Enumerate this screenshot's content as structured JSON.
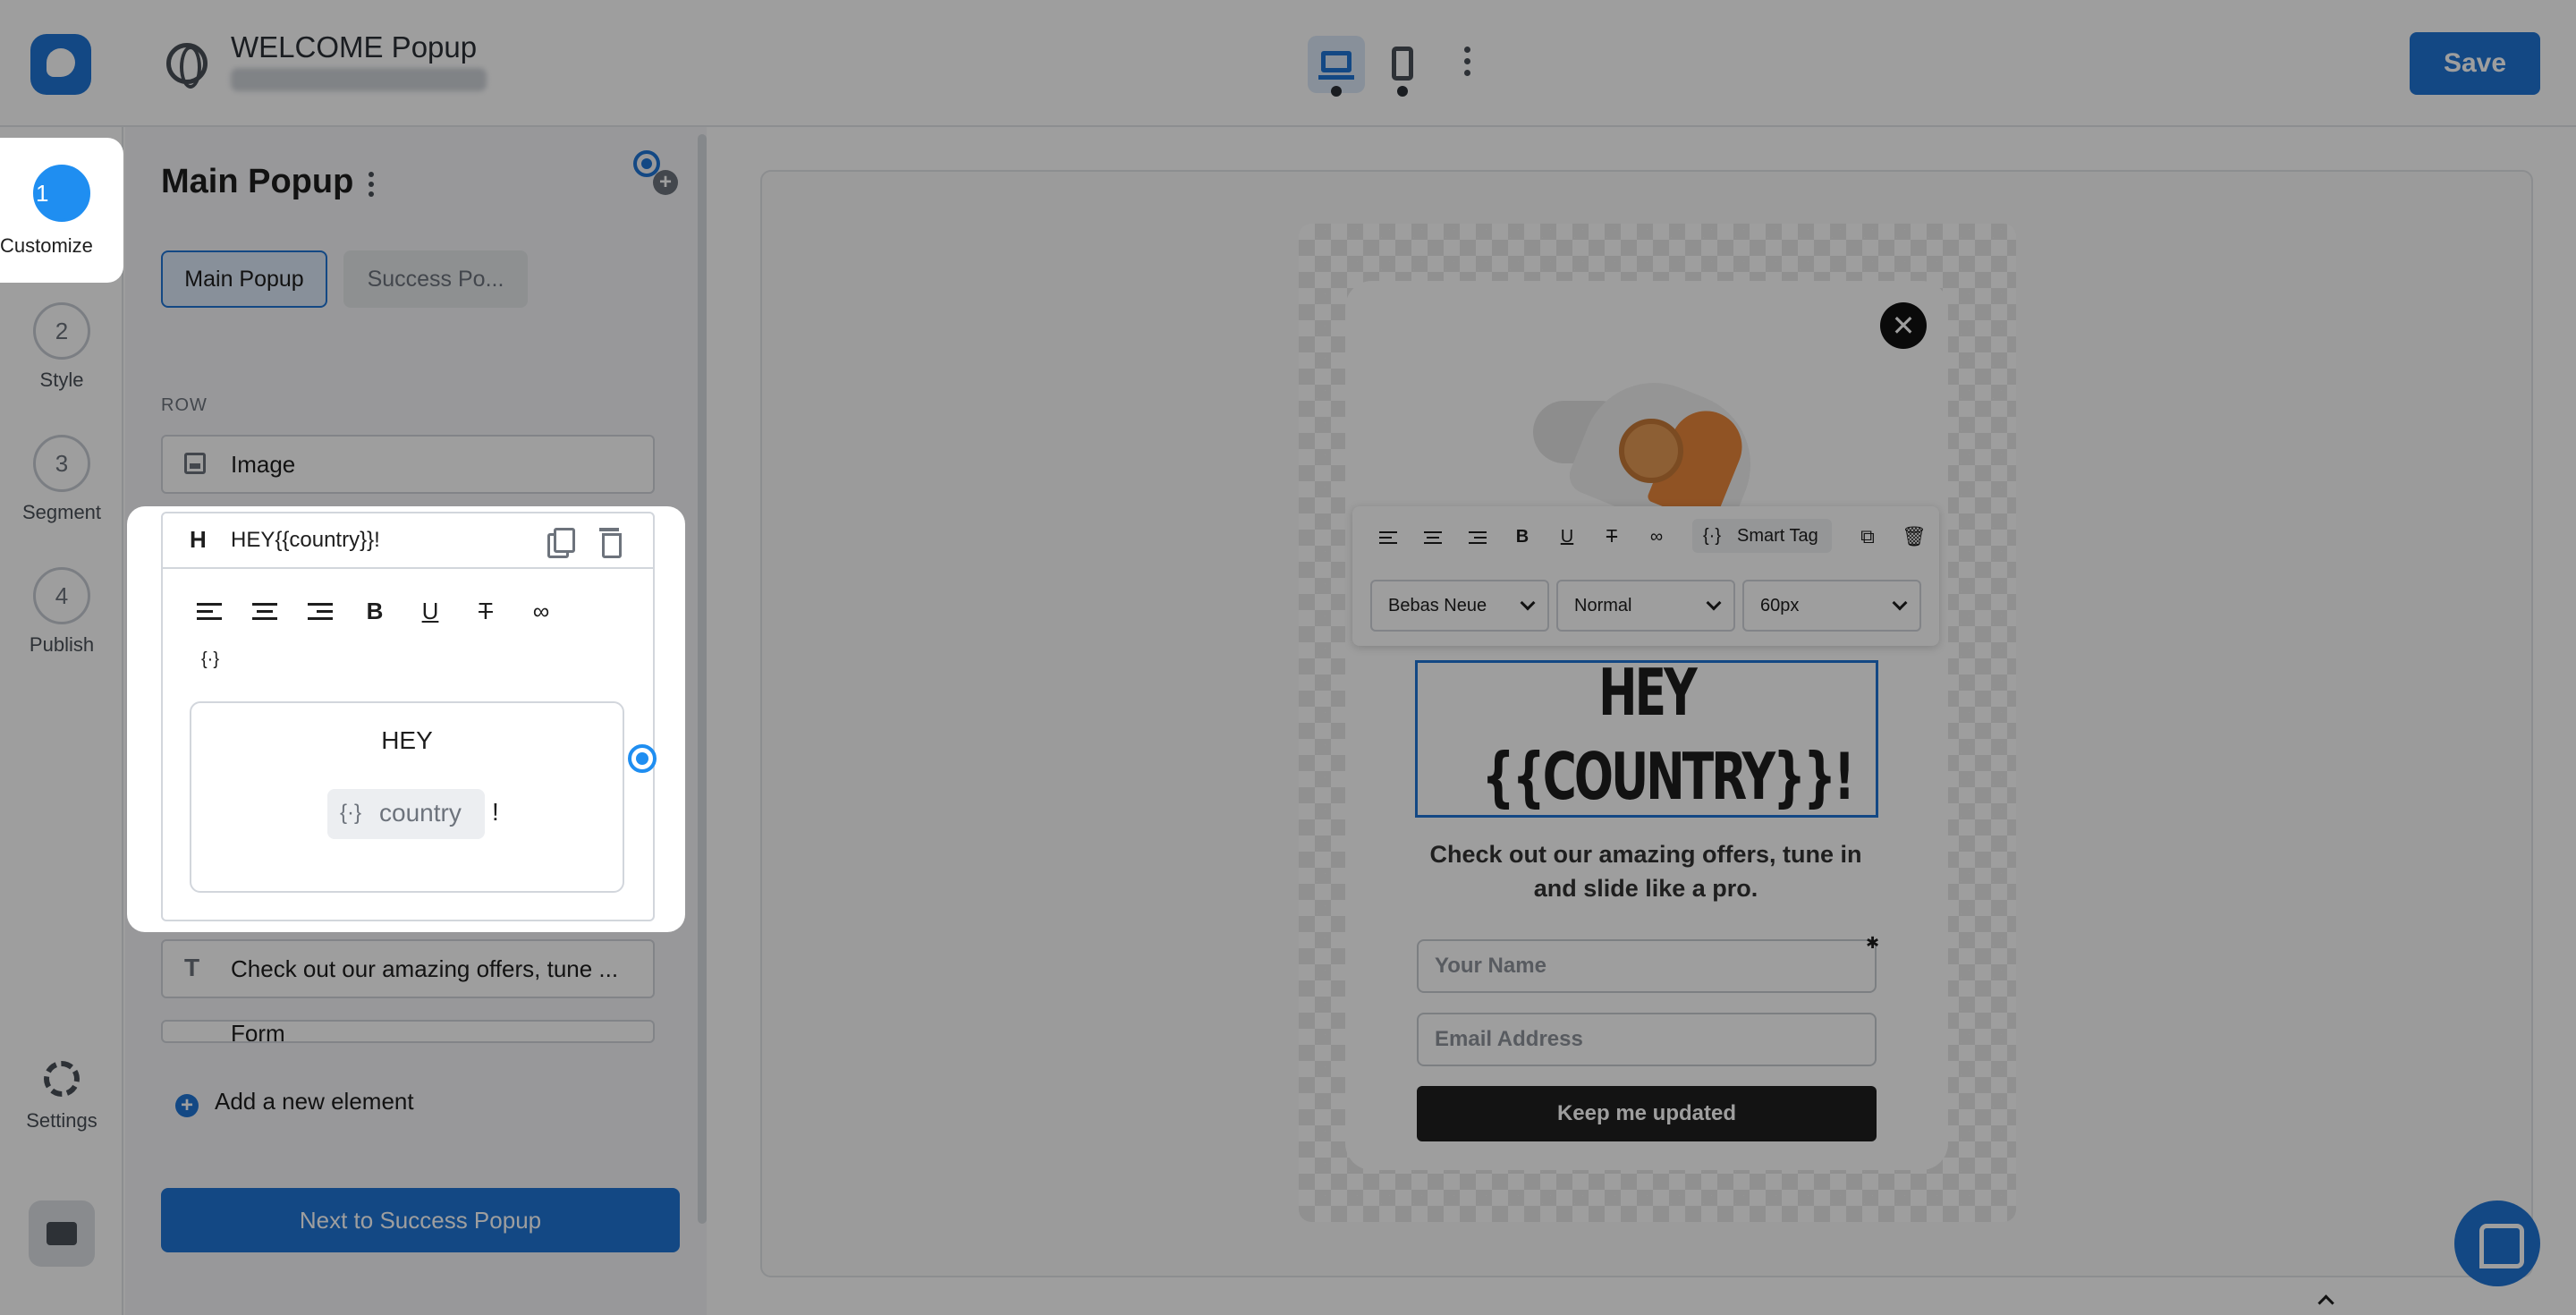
{
  "header": {
    "title": "WELCOME Popup",
    "save_label": "Save"
  },
  "steps": [
    {
      "number": "1",
      "label": "Customize"
    },
    {
      "number": "2",
      "label": "Style"
    },
    {
      "number": "3",
      "label": "Segment"
    },
    {
      "number": "4",
      "label": "Publish"
    }
  ],
  "settings_label": "Settings",
  "panel": {
    "title": "Main Popup",
    "tabs": [
      "Main Popup",
      "Success Po..."
    ],
    "row_label": "ROW",
    "elements": {
      "image": "Image",
      "heading": "HEY{{country}}!",
      "text": "Check out our amazing offers, tune ...",
      "form": "Form"
    },
    "editor": {
      "line1": "HEY",
      "chip": "country",
      "suffix": "!"
    },
    "add_element": "Add a new element",
    "next_button": "Next to Success Popup"
  },
  "popup": {
    "toolbar": {
      "smart_tag": "Smart Tag",
      "font": "Bebas Neue",
      "weight": "Normal",
      "size": "60px"
    },
    "headline_1": "HEY",
    "headline_2": "{{COUNTRY}}!",
    "body": "Check out our amazing offers, tune in and slide like a pro.",
    "name_placeholder": "Your Name",
    "email_placeholder": "Email Address",
    "cta": "Keep me updated"
  },
  "icons": [
    "globe-icon",
    "desktop-icon",
    "mobile-icon",
    "more-icon",
    "gear-icon",
    "briefcase-icon",
    "close-icon",
    "chat-icon"
  ],
  "colors": {
    "accent": "#1f74d6",
    "overlay": "rgba(0,0,0,0.38)",
    "active_step": "#1f8ef1"
  }
}
